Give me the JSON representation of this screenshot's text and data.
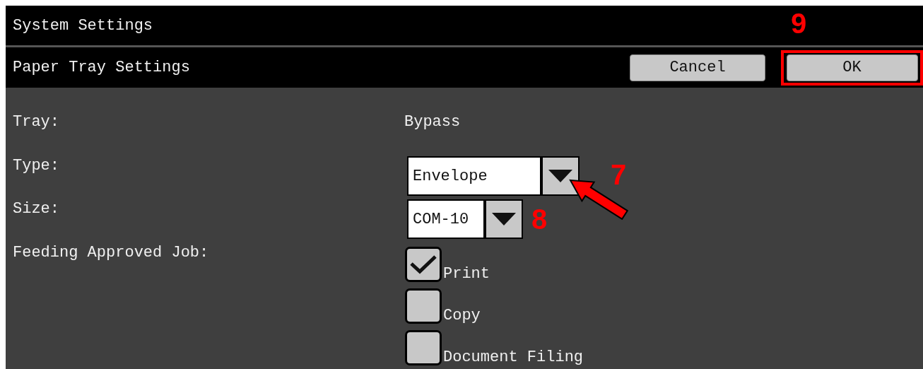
{
  "window": {
    "title": "System Settings"
  },
  "header": {
    "title": "Paper Tray Settings",
    "buttons": [
      {
        "label": "Cancel",
        "highlighted": false
      },
      {
        "label": "OK",
        "highlighted": true,
        "callout": "9"
      }
    ]
  },
  "fields": [
    {
      "kind": "text",
      "label": "Tray:",
      "value": "Bypass"
    },
    {
      "kind": "dropdown",
      "label": "Type:",
      "value": "Envelope",
      "callout": "7",
      "arrow": true
    },
    {
      "kind": "dropdown",
      "label": "Size:",
      "value": "COM-10",
      "callout": "8",
      "arrow": false
    },
    {
      "kind": "checkboxes",
      "label": "Feeding Approved Job:",
      "options": [
        {
          "label": "Print",
          "checked": true
        },
        {
          "label": "Copy",
          "checked": false
        },
        {
          "label": "Document Filing",
          "checked": false
        }
      ]
    }
  ]
}
